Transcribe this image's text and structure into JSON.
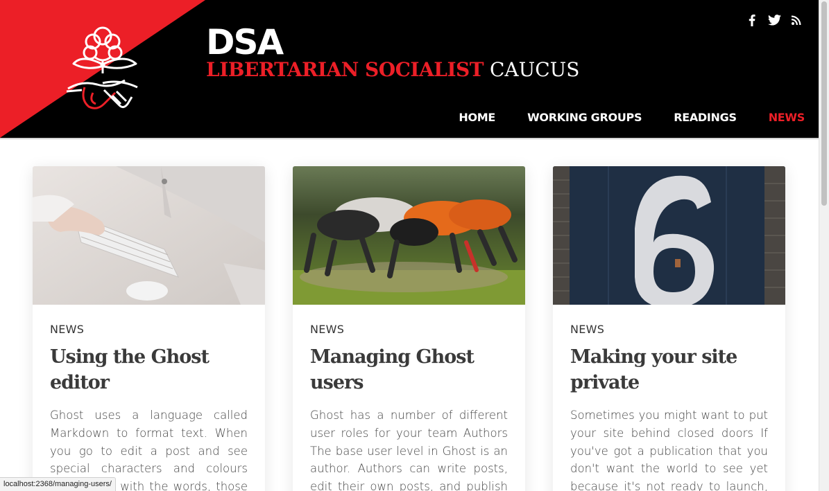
{
  "brand": {
    "title": "DSA",
    "subtitle_red": "LIBERTARIAN SOCIALIST",
    "subtitle_white": "CAUCUS",
    "colors": {
      "accent": "#ec1f27",
      "header_bg": "#000000"
    }
  },
  "social": [
    {
      "icon": "facebook-icon"
    },
    {
      "icon": "twitter-icon"
    },
    {
      "icon": "rss-icon"
    }
  ],
  "nav": {
    "items": [
      {
        "label": "HOME",
        "active": false
      },
      {
        "label": "WORKING GROUPS",
        "active": false
      },
      {
        "label": "READINGS",
        "active": false
      },
      {
        "label": "NEWS",
        "active": true
      }
    ]
  },
  "cards": [
    {
      "tag": "NEWS",
      "title": "Using the Ghost editor",
      "excerpt": "Ghost uses a language called Markdown to format text. When you go to edit a post and see special characters and colours intertwined with the words, those are",
      "image": "laptop-keyboard-photo"
    },
    {
      "tag": "NEWS",
      "title": "Managing Ghost users",
      "excerpt": "Ghost has a number of different user roles for your team Authors The base user level in Ghost is an author. Authors can write posts, edit their own posts, and publish their",
      "image": "rugby-scrum-photo"
    },
    {
      "tag": "NEWS",
      "title": "Making your site private",
      "excerpt": "Sometimes you might want to put your site behind closed doors If you've got a publication that you don't want the world to see yet because it's not ready to launch, you",
      "image": "door-number-six-photo"
    }
  ],
  "statusbar": {
    "url": "localhost:2368/managing-users/"
  }
}
